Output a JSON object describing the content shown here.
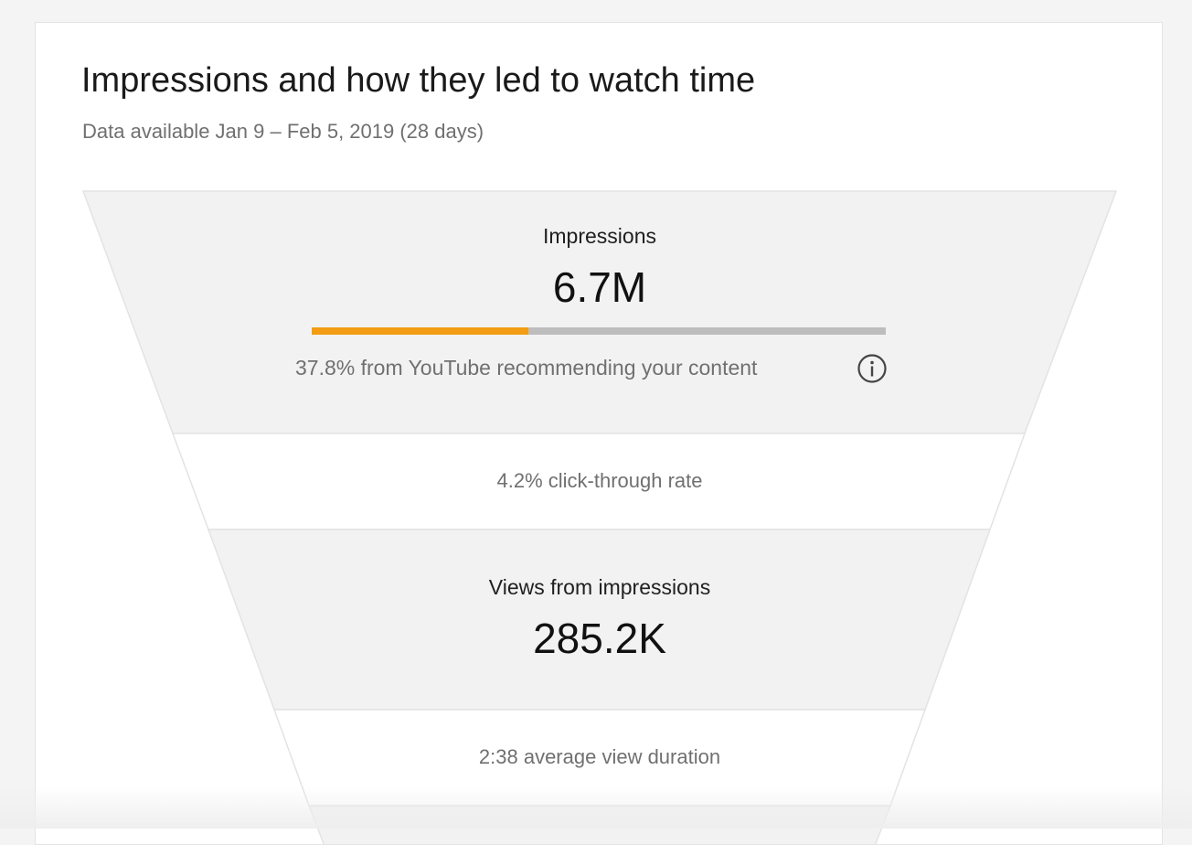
{
  "card": {
    "title": "Impressions and how they led to watch time",
    "subtitle": "Data available Jan 9 – Feb 5, 2019 (28 days)"
  },
  "funnel": {
    "impressions": {
      "label": "Impressions",
      "value": "6.7M",
      "source_text": "37.8% from YouTube recommending your content",
      "source_fraction": 0.378
    },
    "ctr": {
      "text": "4.2% click-through rate"
    },
    "views": {
      "label": "Views from impressions",
      "value": "285.2K"
    },
    "avd": {
      "text": "2:38 average view duration"
    }
  },
  "icons": {
    "info": "info-icon"
  },
  "colors": {
    "accent": "#f29d14",
    "track": "#bdbdbd",
    "band_shaded": "#f2f2f2",
    "band_white": "#ffffff",
    "funnel_edge": "#e3e3e3"
  }
}
